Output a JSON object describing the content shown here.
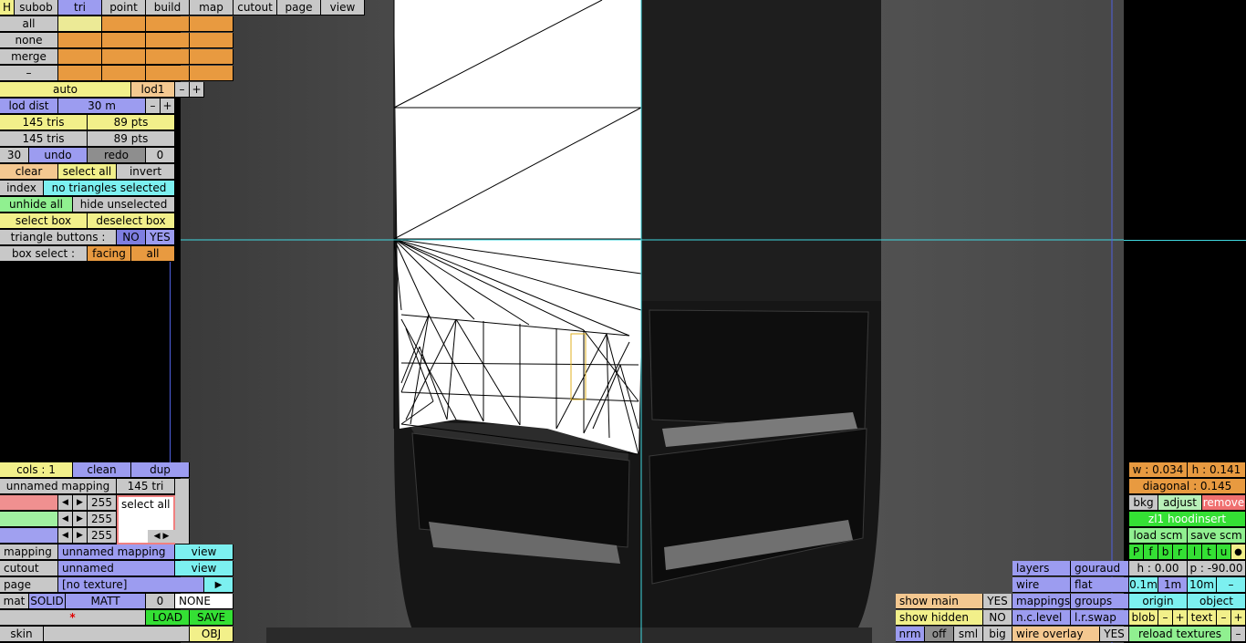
{
  "menu": {
    "h": "H",
    "subob": "subob",
    "tri": "tri",
    "point": "point",
    "build": "build",
    "map": "map",
    "cutout": "cutout",
    "page": "page",
    "view": "view"
  },
  "sel": {
    "all": "all",
    "none": "none",
    "merge": "merge",
    "minus": "–"
  },
  "lod": {
    "auto": "auto",
    "lod1": "lod1",
    "minus": "–",
    "plus": "+",
    "dist_label": "lod dist",
    "dist_value": "30 m"
  },
  "counts": {
    "tris1": "145 tris",
    "pts1": "89 pts",
    "tris2": "145 tris",
    "pts2": "89 pts"
  },
  "undo": {
    "left": "30",
    "undo": "undo",
    "redo": "redo",
    "right": "0"
  },
  "actions": {
    "clear": "clear",
    "select_all": "select all",
    "invert": "invert"
  },
  "index": {
    "label": "index",
    "status": "no triangles selected"
  },
  "hide": {
    "unhide_all": "unhide all",
    "hide_unselected": "hide unselected"
  },
  "box": {
    "select_box": "select box",
    "deselect_box": "deselect box"
  },
  "tri_buttons": {
    "label": "triangle buttons :",
    "no": "NO",
    "yes": "YES"
  },
  "box_select": {
    "label": "box select :",
    "facing": "facing",
    "all": "all"
  },
  "cols": {
    "cols": "cols : 1",
    "clean": "clean",
    "dup": "dup"
  },
  "mapping_info": {
    "name": "unnamed mapping",
    "tri": "145 tri"
  },
  "color_rows": [
    {
      "color": "#f09090",
      "value": "255"
    },
    {
      "color": "#a0f0a0",
      "value": "255"
    },
    {
      "color": "#a0a0f0",
      "value": "255"
    }
  ],
  "color_arrows": {
    "left": "◀",
    "right": "▶"
  },
  "list": {
    "item": "select all",
    "left": "◀",
    "right": "▶"
  },
  "mapping": {
    "label": "mapping",
    "value": "unnamed mapping",
    "view": "view"
  },
  "cutout": {
    "label": "cutout",
    "value": "unnamed",
    "view": "view"
  },
  "page": {
    "label": "page",
    "value": "[no texture]",
    "arrow": "▶"
  },
  "mat": {
    "label": "mat",
    "solid": "SOLID",
    "matt": "MATT",
    "num": "0",
    "none": "NONE"
  },
  "file": {
    "star": "*",
    "load": "LOAD",
    "save": "SAVE"
  },
  "skin": {
    "label": "skin",
    "obj": "OBJ"
  },
  "dims": {
    "w": "w : 0.034",
    "h": "h : 0.141",
    "diagonal": "diagonal : 0.145"
  },
  "bkg": {
    "bkg": "bkg",
    "adjust": "adjust",
    "remove": "remove"
  },
  "texture_name": "zl1 hoodinsert",
  "scm": {
    "load": "load scm",
    "save": "save scm"
  },
  "letters": [
    "P",
    "f",
    "b",
    "r",
    "l",
    "t",
    "u",
    "●"
  ],
  "render": {
    "layers": "layers",
    "gouraud": "gouraud",
    "wire": "wire",
    "flat": "flat",
    "mappings": "mappings",
    "groups": "groups",
    "nclevel": "n.c.level",
    "lrswap": "l.r.swap",
    "wire_overlay": "wire overlay",
    "wire_overlay_value": "YES"
  },
  "angles": {
    "h": "h : 0.00",
    "p": "p : -90.00"
  },
  "grid": {
    "a": "0.1m",
    "b": "1m",
    "c": "10m",
    "minus": "–"
  },
  "origin": {
    "origin": "origin",
    "object": "object"
  },
  "blob": {
    "blob": "blob",
    "minus": "–",
    "plus": "+",
    "text": "text",
    "tminus": "–",
    "tplus": "+"
  },
  "reload": {
    "label": "reload textures",
    "minus": "–"
  },
  "show": {
    "main": "show main",
    "main_value": "YES",
    "hidden": "show hidden",
    "hidden_value": "NO"
  },
  "normals": {
    "nrm": "nrm",
    "off": "off",
    "sml": "sml",
    "big": "big"
  }
}
